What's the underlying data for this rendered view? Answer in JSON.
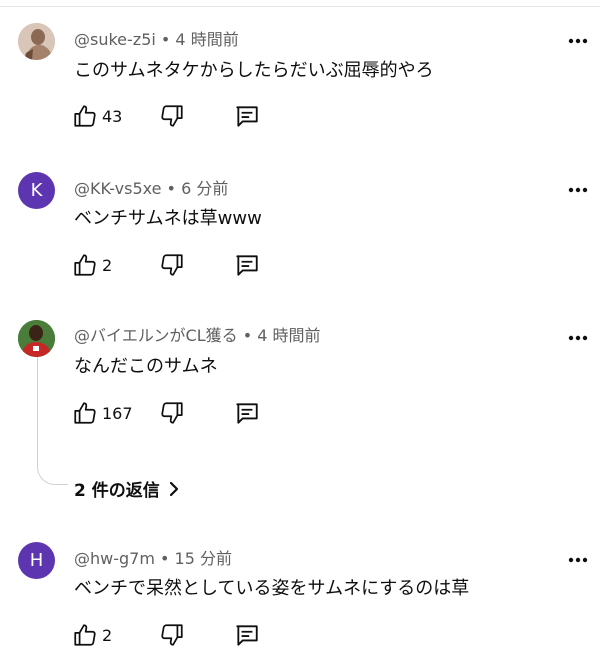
{
  "comments": [
    {
      "author": "@suke-z5i",
      "time": "4 時間前",
      "text": "このサムネタケからしたらだいぶ屈辱的やろ",
      "likes": "43",
      "avatar_letter": "",
      "avatar_color": "#b89a86"
    },
    {
      "author": "@KK-vs5xe",
      "time": "6 分前",
      "text": "ベンチサムネは草www",
      "likes": "2",
      "avatar_letter": "K",
      "avatar_color": "#5e35b1"
    },
    {
      "author": "@バイエルンがCL獲る",
      "time": "4 時間前",
      "text": "なんだこのサムネ",
      "likes": "167",
      "avatar_letter": "",
      "avatar_color": "#c0392b"
    },
    {
      "author": "@hw-g7m",
      "time": "15 分前",
      "text": "ベンチで呆然としている姿をサムネにするのは草",
      "likes": "2",
      "avatar_letter": "H",
      "avatar_color": "#5e35b1"
    }
  ],
  "replies_label": "2 件の返信",
  "separator": " • ",
  "icons": {
    "like": "thumbs-up-icon",
    "dislike": "thumbs-down-icon",
    "reply": "reply-icon",
    "more": "more-vert-icon",
    "chevron": "chevron-right-icon"
  }
}
